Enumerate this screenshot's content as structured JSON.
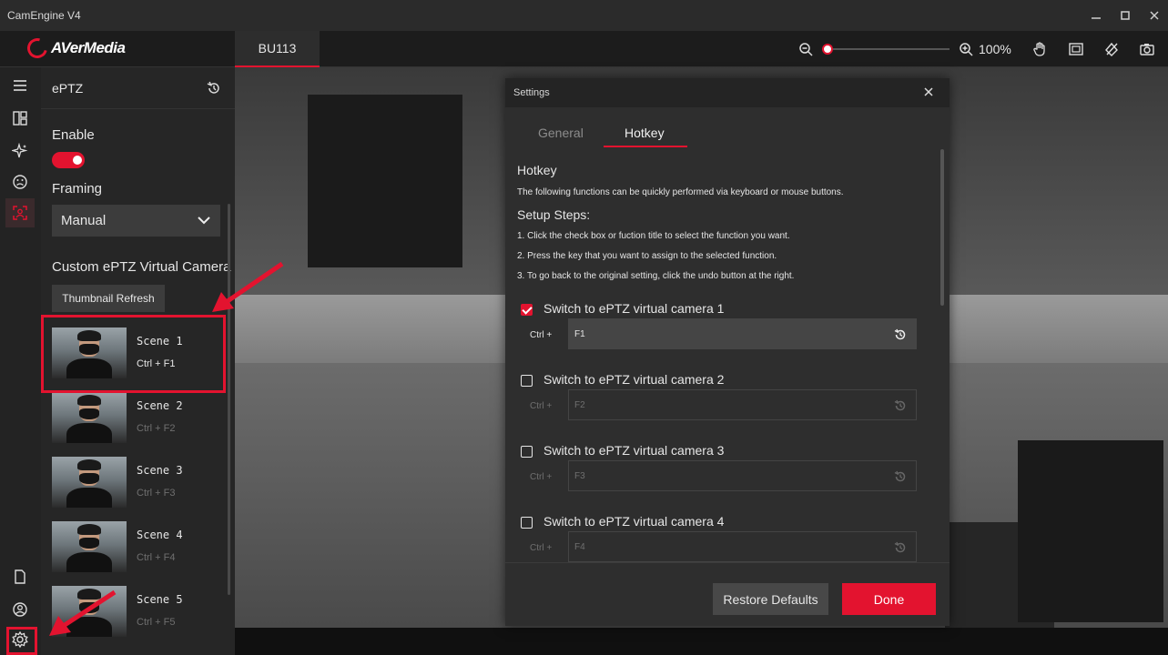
{
  "app": {
    "title": "CamEngine V4",
    "brand": "AVerMedia",
    "accent": "#e3132f"
  },
  "device_tab": "BU113",
  "zoom": {
    "value_label": "100%",
    "slider_fraction": 0.0
  },
  "panel": {
    "title": "ePTZ",
    "enable_label": "Enable",
    "enable_on": true,
    "framing_label": "Framing",
    "framing_value": "Manual",
    "custom_label": "Custom ePTZ Virtual Camera",
    "refresh_label": "Thumbnail Refresh",
    "scenes": [
      {
        "name": "Scene 1",
        "key": "Ctrl + F1"
      },
      {
        "name": "Scene 2",
        "key": "Ctrl + F2"
      },
      {
        "name": "Scene 3",
        "key": "Ctrl + F3"
      },
      {
        "name": "Scene 4",
        "key": "Ctrl + F4"
      },
      {
        "name": "Scene 5",
        "key": "Ctrl + F5"
      }
    ]
  },
  "dialog": {
    "title": "Settings",
    "tabs": [
      "General",
      "Hotkey"
    ],
    "active_tab": "Hotkey",
    "heading": "Hotkey",
    "description": "The following functions can be quickly performed via keyboard or mouse buttons.",
    "steps_heading": "Setup Steps:",
    "steps": [
      "1. Click the check box or fuction title to select the function you want.",
      "2. Press the key that you want to assign to the selected function.",
      "3. To go back to the original setting, click the undo button at the right."
    ],
    "hotkeys": [
      {
        "label": "Switch to ePTZ virtual camera 1",
        "modifier": "Ctrl +",
        "key": "F1",
        "checked": true
      },
      {
        "label": "Switch to ePTZ virtual camera 2",
        "modifier": "Ctrl +",
        "key": "F2",
        "checked": false
      },
      {
        "label": "Switch to ePTZ virtual camera 3",
        "modifier": "Ctrl +",
        "key": "F3",
        "checked": false
      },
      {
        "label": "Switch to ePTZ virtual camera 4",
        "modifier": "Ctrl +",
        "key": "F4",
        "checked": false
      }
    ],
    "restore_label": "Restore Defaults",
    "done_label": "Done"
  }
}
